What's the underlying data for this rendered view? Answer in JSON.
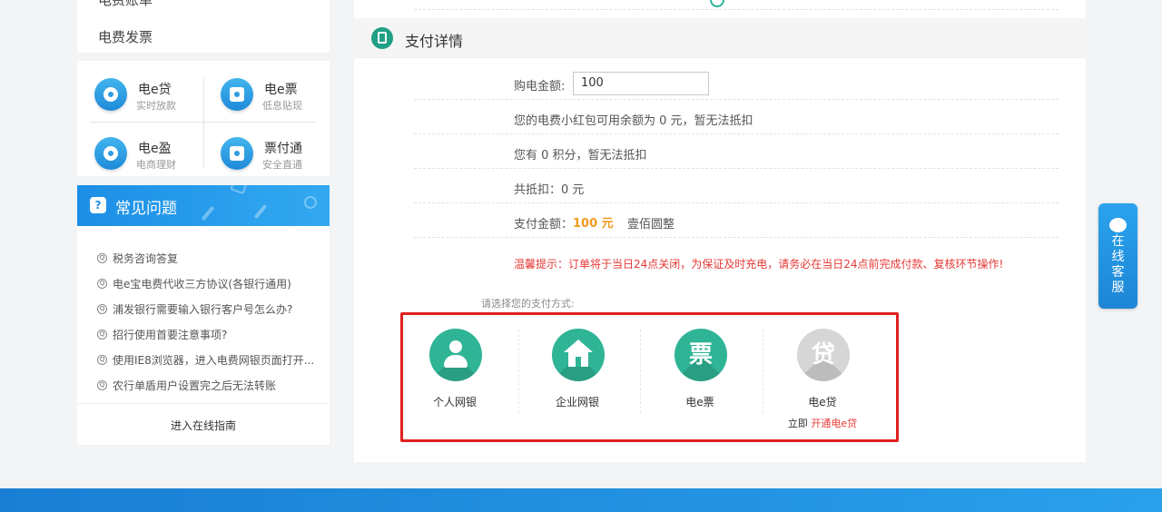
{
  "sidebar": {
    "partial_item": "电费账单",
    "invoice_label": "电费发票",
    "products": [
      {
        "name": "电e贷",
        "sub": "实时放款",
        "icon": "loan-icon"
      },
      {
        "name": "电e票",
        "sub": "低息贴现",
        "icon": "ticket-icon"
      },
      {
        "name": "电e盈",
        "sub": "电商理财",
        "icon": "finance-icon"
      },
      {
        "name": "票付通",
        "sub": "安全直通",
        "icon": "payment-icon"
      }
    ],
    "faq": {
      "title": "常见问题",
      "items": [
        "税务咨询答复",
        "电e宝电费代收三方协议(各银行通用)",
        "浦发银行需要输入银行客户号怎么办?",
        "招行使用首要注意事项?",
        "使用IE8浏览器，进入电费网银页面打开...",
        "农行单盾用户设置完之后无法转账"
      ],
      "guide": "进入在线指南"
    }
  },
  "payment": {
    "section_title": "支付详情",
    "amount_label": "购电金额:",
    "amount_value": "100",
    "redpacket_text": "您的电费小红包可用余额为 0 元，暂无法抵扣",
    "points_text": "您有 0 积分，暂无法抵扣",
    "deduct_text": "共抵扣：0 元",
    "pay_amount_label": "支付金额：",
    "pay_amount_value": "100 元",
    "pay_amount_words": "壹佰圆整",
    "warning": "温馨提示：订单将于当日24点关闭，为保证及时充电，请务必在当日24点前完成付款、复核环节操作!",
    "choose_label": "请选择您的支付方式:",
    "methods": [
      {
        "label": "个人网银",
        "icon": "person-icon",
        "color": "#2fb496"
      },
      {
        "label": "企业网银",
        "icon": "house-icon",
        "color": "#2fb496"
      },
      {
        "label": "电e票",
        "icon": "ticket-char-icon",
        "glyph": "票",
        "color": "#2fb496"
      },
      {
        "label": "电e贷",
        "icon": "loan-char-icon",
        "glyph": "贷",
        "color": "#d6d6d6",
        "sub_prefix": "立即",
        "sub_link": "开通电e贷"
      }
    ]
  },
  "float_service": {
    "label": "在线客服",
    "icon": "chat-bubble-icon"
  },
  "colors": {
    "accent_green": "#2fb496",
    "brand_blue": "#1c8fe6",
    "warning_red": "#e53935",
    "amount_orange": "#f39a1e",
    "highlight_border": "#e02020"
  }
}
